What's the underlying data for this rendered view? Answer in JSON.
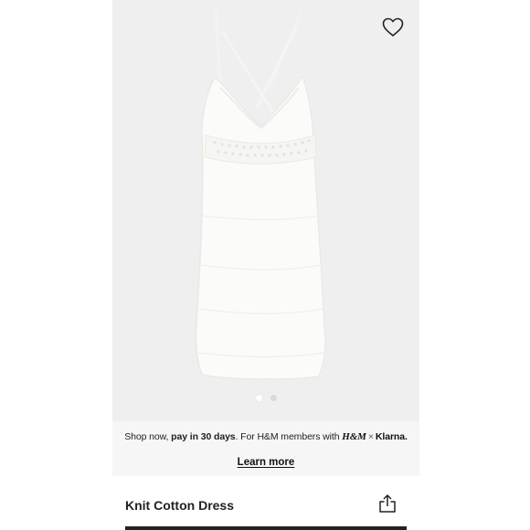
{
  "product": {
    "name": "Knit Cotton Dress"
  },
  "gallery": {
    "image_count": 2,
    "active_index": 0
  },
  "promo": {
    "text_prefix": "Shop now, ",
    "text_bold": "pay in 30 days",
    "text_suffix": ". For H&M members with ",
    "brand_hm": "H&M",
    "brand_separator": "×",
    "brand_klarna": "Klarna.",
    "learn_more_label": "Learn more"
  },
  "icons": {
    "wishlist": "heart-outline-icon",
    "share": "share-icon"
  },
  "colors": {
    "background": "#efefef",
    "promo_background": "#f6f6f6",
    "text": "#222222",
    "dress": "#fbfbf9"
  }
}
